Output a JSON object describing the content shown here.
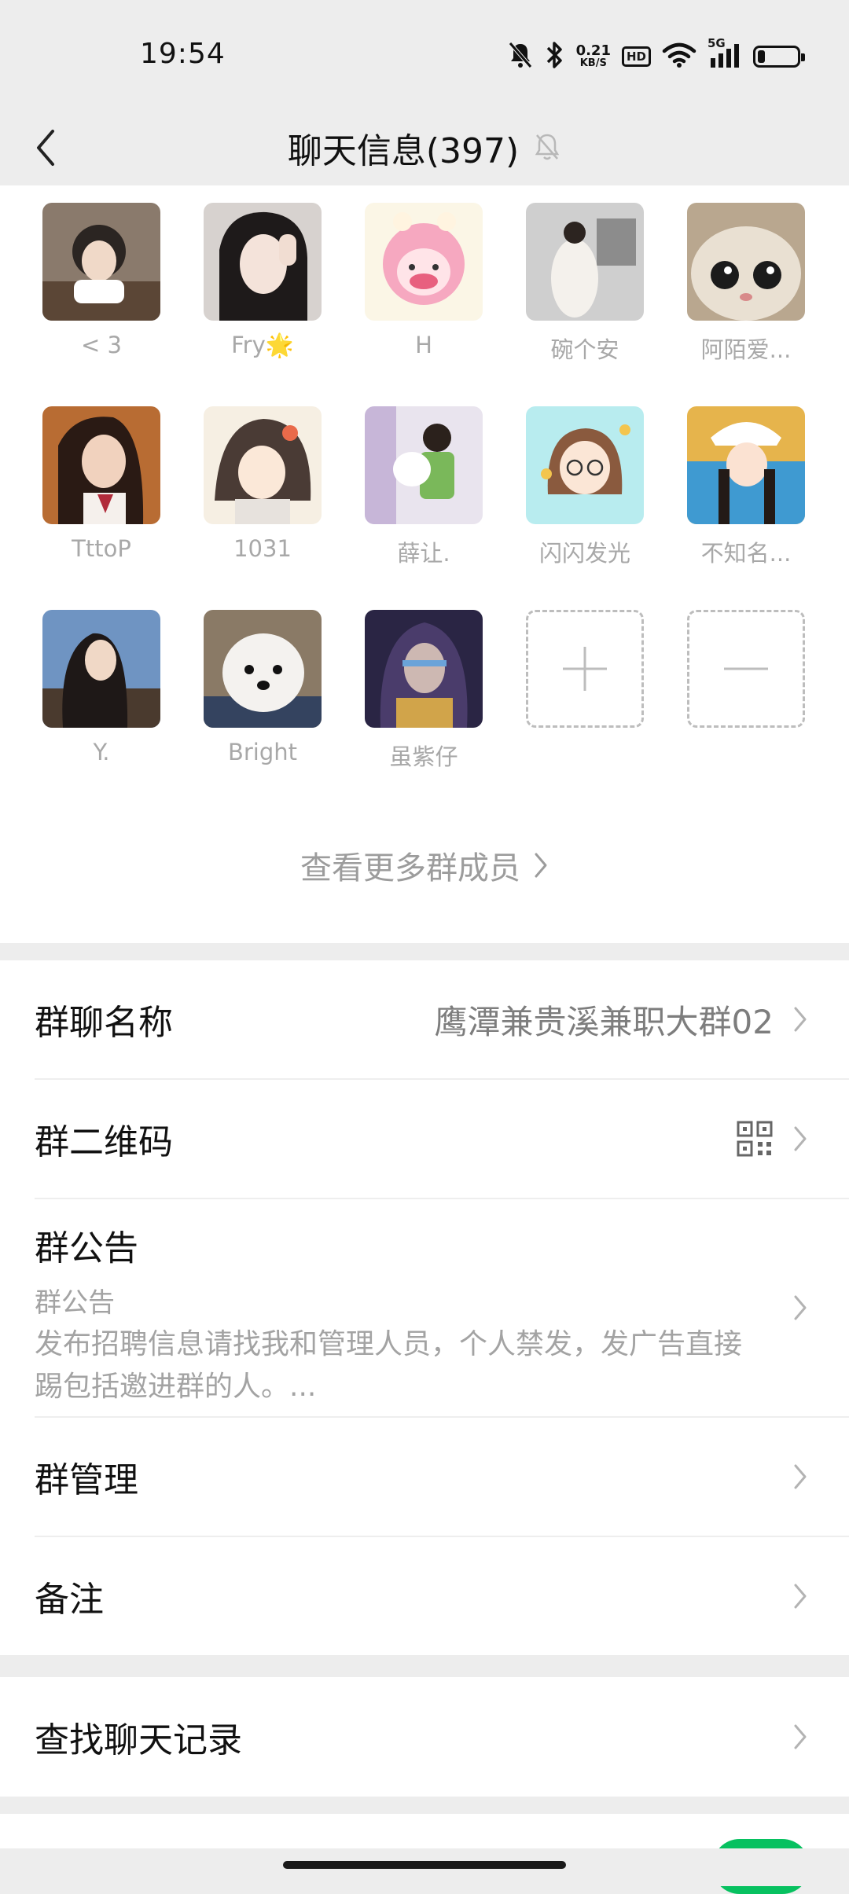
{
  "status_bar": {
    "time": "19:54",
    "net_speed_value": "0.21",
    "net_speed_unit": "KB/S",
    "hd_badge": "HD",
    "signal_label": "5G",
    "battery_level": 0.2
  },
  "nav": {
    "title": "聊天信息(397)",
    "back_icon": "chevron-left-icon",
    "mute_icon": "bell-off-icon"
  },
  "members": [
    {
      "name": "< 3"
    },
    {
      "name": "Fry🌟"
    },
    {
      "name": "H"
    },
    {
      "name": "碗个安"
    },
    {
      "name": "阿陌爱..."
    },
    {
      "name": "TttoP"
    },
    {
      "name": "1031"
    },
    {
      "name": "薛让."
    },
    {
      "name": "闪闪发光"
    },
    {
      "name": "不知名..."
    },
    {
      "name": "Y."
    },
    {
      "name": "Bright"
    },
    {
      "name": "虽紫仔"
    }
  ],
  "more_members": "查看更多群成员",
  "settings": {
    "group_name_label": "群聊名称",
    "group_name_value": "鹰潭兼贵溪兼职大群02",
    "qr_label": "群二维码",
    "notice_label": "群公告",
    "notice_sub": "群公告",
    "notice_text": "发布招聘信息请找我和管理人员，个人禁发，发广告直接踢包括邀进群的人。...",
    "manage_label": "群管理",
    "remark_label": "备注",
    "search_history_label": "查找聊天记录"
  },
  "colors": {
    "background": "#ededed",
    "card": "#ffffff",
    "toggle_on": "#07c160"
  }
}
